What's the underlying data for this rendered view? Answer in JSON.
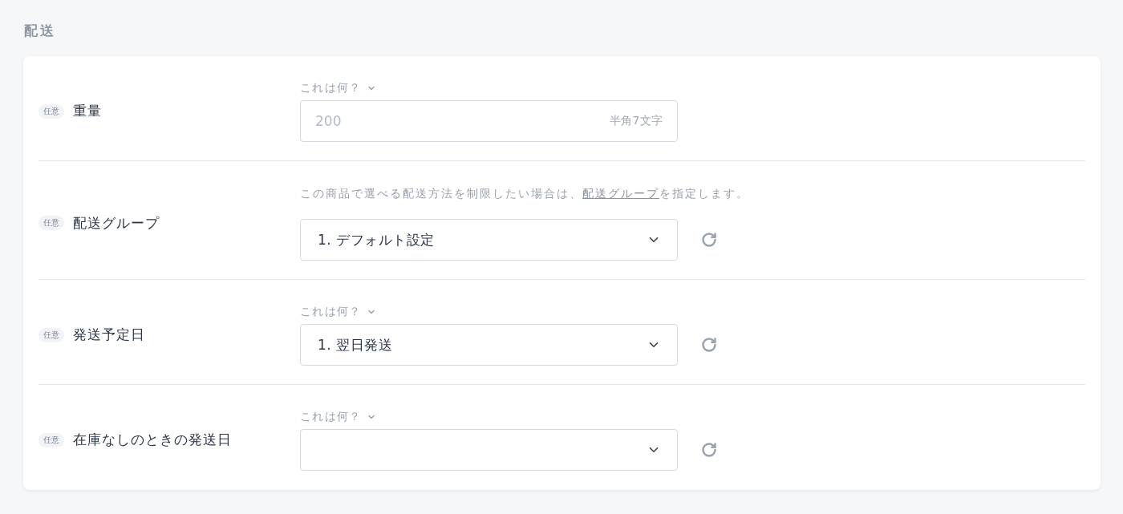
{
  "section_title": "配送",
  "fields": [
    {
      "kind": "text",
      "badge": "任意",
      "label": "重量",
      "help": "これは何？",
      "placeholder": "200",
      "hint": "半角7文字"
    },
    {
      "kind": "select",
      "badge": "任意",
      "label": "配送グループ",
      "description": {
        "before": "この商品で選べる配送方法を制限したい場合は、",
        "link": "配送グループ",
        "after": "を指定します。"
      },
      "value": "1. デフォルト設定"
    },
    {
      "kind": "select",
      "badge": "任意",
      "label": "発送予定日",
      "help": "これは何？",
      "value": "1. 翌日発送"
    },
    {
      "kind": "select",
      "badge": "任意",
      "label": "在庫なしのときの発送日",
      "help": "これは何？"
    }
  ]
}
